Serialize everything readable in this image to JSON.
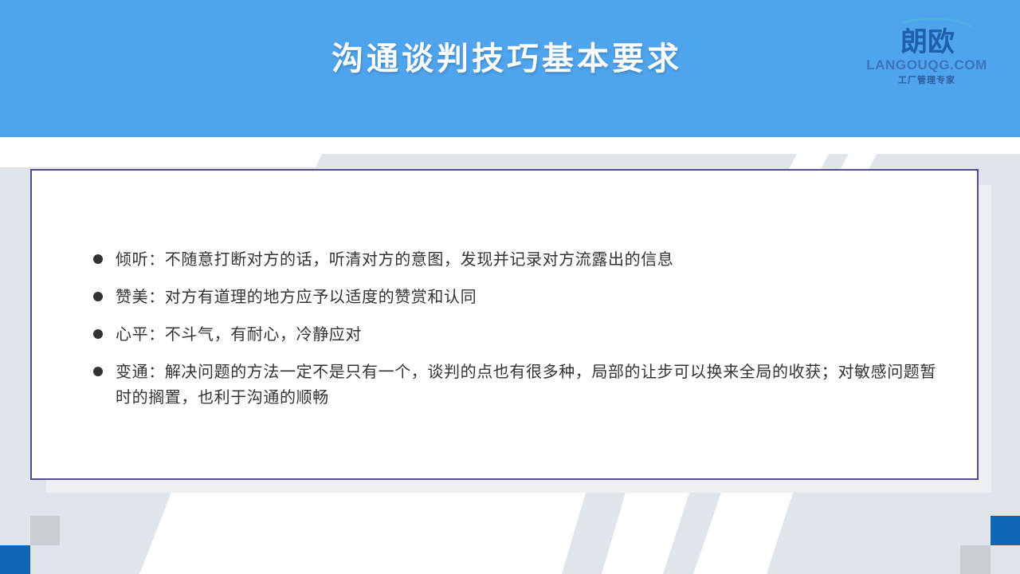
{
  "slide": {
    "title": "沟通谈判技巧基本要求"
  },
  "logo": {
    "mark_text": "朗欧",
    "domain": "LANGOUQG.COM",
    "slogan": "工厂管理专家"
  },
  "bullets": [
    {
      "text": "倾听：不随意打断对方的话，听清对方的意图，发现并记录对方流露出的信息"
    },
    {
      "text": "赞美：对方有道理的地方应予以适度的赞赏和认同"
    },
    {
      "text": "心平：不斗气，有耐心，冷静应对"
    },
    {
      "text": "变通：解决问题的方法一定不是只有一个，谈判的点也有很多种，局部的让步可以换来全局的收获；对敏感问题暂时的搁置，也利于沟通的顺畅"
    }
  ],
  "colors": {
    "header": "#4fa4ee",
    "panel_border": "#574b8f",
    "background_band": "#dfe5ea",
    "accent_blue": "#1167b4",
    "accent_gray": "#c9ced3"
  }
}
